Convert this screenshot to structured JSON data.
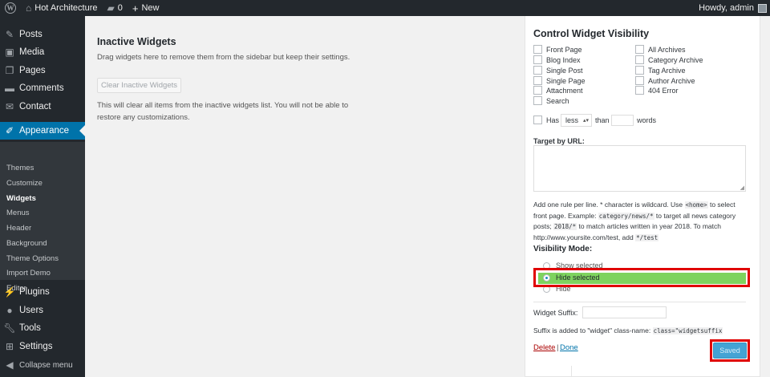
{
  "adminbar": {
    "site_name": "Hot Architecture",
    "comments_count": "0",
    "new_label": "New",
    "greeting": "Howdy, admin"
  },
  "sidebar": {
    "items": [
      {
        "label": "Posts",
        "icon": "pin-icon"
      },
      {
        "label": "Media",
        "icon": "media-icon"
      },
      {
        "label": "Pages",
        "icon": "pages-icon"
      },
      {
        "label": "Comments",
        "icon": "comments-icon"
      },
      {
        "label": "Contact",
        "icon": "mail-icon"
      },
      {
        "label": "Appearance",
        "icon": "paintbrush-icon"
      },
      {
        "label": "Plugins",
        "icon": "plugin-icon"
      },
      {
        "label": "Users",
        "icon": "users-icon"
      },
      {
        "label": "Tools",
        "icon": "wrench-icon"
      },
      {
        "label": "Settings",
        "icon": "settings-icon"
      },
      {
        "label": "Collapse menu",
        "icon": "collapse-icon"
      }
    ],
    "submenu": [
      "Themes",
      "Customize",
      "Widgets",
      "Menus",
      "Header",
      "Background",
      "Theme Options",
      "Import Demo",
      "Editor"
    ],
    "current_item": "Appearance",
    "current_sub": "Widgets"
  },
  "main": {
    "inactive_title": "Inactive Widgets",
    "inactive_desc": "Drag widgets here to remove them from the sidebar but keep their settings.",
    "clear_button": "Clear Inactive Widgets",
    "clear_desc": "This will clear all items from the inactive widgets list. You will not be able to restore any customizations."
  },
  "panel": {
    "title": "Control Widget Visibility",
    "checkboxes_left": [
      "Front Page",
      "Blog Index",
      "Single Post",
      "Single Page",
      "Attachment",
      "Search"
    ],
    "checkboxes_right": [
      "All Archives",
      "Category Archive",
      "Tag Archive",
      "Author Archive",
      "404 Error"
    ],
    "has_label": "Has",
    "comparison_value": "less",
    "than_label": "than",
    "words_label": "words",
    "target_url_label": "Target by URL:",
    "help": {
      "t1": "Add one rule per line. * character is wildcard. Use ",
      "c1": "<home>",
      "t2": " to select front page. Example: ",
      "c2": "category/news/*",
      "t3": " to target all news category posts; ",
      "c3": "2018/*",
      "t4": " to match articles written in year 2018. To match http://www.yoursite.com/test, add ",
      "c4": "*/test"
    },
    "visibility_mode_label": "Visibility Mode:",
    "modes": [
      "Show selected",
      "Hide selected",
      "Hide"
    ],
    "selected_mode": "Hide selected",
    "suffix_label": "Widget Suffix:",
    "suffix_help_text": "Suffix is added to \"widget\" class-name: ",
    "suffix_help_code": "class=\"widgetsuffix",
    "delete_label": "Delete",
    "separator": "|",
    "done_label": "Done",
    "saved_button": "Saved"
  },
  "colors": {
    "admin_dark": "#23282d",
    "accent_blue": "#0073aa",
    "highlight_green": "#7ed35e",
    "annotation_red": "#e00000"
  }
}
